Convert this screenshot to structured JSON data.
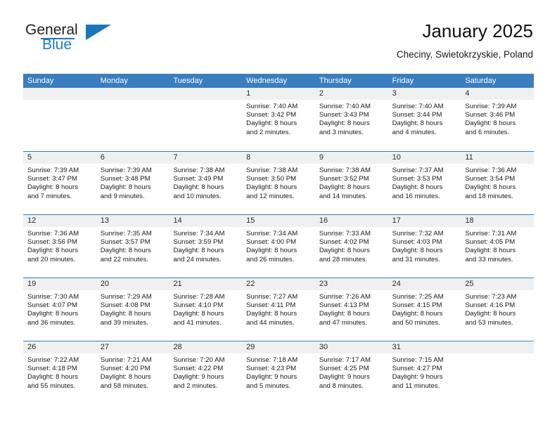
{
  "brand": {
    "name_part1": "General",
    "name_part2": "Blue",
    "accent_color": "#1b75bb"
  },
  "header": {
    "title": "January 2025",
    "location": "Checiny, Swietokrzyskie, Poland"
  },
  "calendar": {
    "header_bg": "#3a7ebf",
    "daynumber_bg": "#f0f0f0",
    "weekdays": [
      "Sunday",
      "Monday",
      "Tuesday",
      "Wednesday",
      "Thursday",
      "Friday",
      "Saturday"
    ],
    "weeks": [
      [
        {
          "day": "",
          "sunrise": "",
          "sunset": "",
          "daylight_line1": "",
          "daylight_line2": ""
        },
        {
          "day": "",
          "sunrise": "",
          "sunset": "",
          "daylight_line1": "",
          "daylight_line2": ""
        },
        {
          "day": "",
          "sunrise": "",
          "sunset": "",
          "daylight_line1": "",
          "daylight_line2": ""
        },
        {
          "day": "1",
          "sunrise": "Sunrise: 7:40 AM",
          "sunset": "Sunset: 3:42 PM",
          "daylight_line1": "Daylight: 8 hours",
          "daylight_line2": "and 2 minutes."
        },
        {
          "day": "2",
          "sunrise": "Sunrise: 7:40 AM",
          "sunset": "Sunset: 3:43 PM",
          "daylight_line1": "Daylight: 8 hours",
          "daylight_line2": "and 3 minutes."
        },
        {
          "day": "3",
          "sunrise": "Sunrise: 7:40 AM",
          "sunset": "Sunset: 3:44 PM",
          "daylight_line1": "Daylight: 8 hours",
          "daylight_line2": "and 4 minutes."
        },
        {
          "day": "4",
          "sunrise": "Sunrise: 7:39 AM",
          "sunset": "Sunset: 3:46 PM",
          "daylight_line1": "Daylight: 8 hours",
          "daylight_line2": "and 6 minutes."
        }
      ],
      [
        {
          "day": "5",
          "sunrise": "Sunrise: 7:39 AM",
          "sunset": "Sunset: 3:47 PM",
          "daylight_line1": "Daylight: 8 hours",
          "daylight_line2": "and 7 minutes."
        },
        {
          "day": "6",
          "sunrise": "Sunrise: 7:39 AM",
          "sunset": "Sunset: 3:48 PM",
          "daylight_line1": "Daylight: 8 hours",
          "daylight_line2": "and 9 minutes."
        },
        {
          "day": "7",
          "sunrise": "Sunrise: 7:38 AM",
          "sunset": "Sunset: 3:49 PM",
          "daylight_line1": "Daylight: 8 hours",
          "daylight_line2": "and 10 minutes."
        },
        {
          "day": "8",
          "sunrise": "Sunrise: 7:38 AM",
          "sunset": "Sunset: 3:50 PM",
          "daylight_line1": "Daylight: 8 hours",
          "daylight_line2": "and 12 minutes."
        },
        {
          "day": "9",
          "sunrise": "Sunrise: 7:38 AM",
          "sunset": "Sunset: 3:52 PM",
          "daylight_line1": "Daylight: 8 hours",
          "daylight_line2": "and 14 minutes."
        },
        {
          "day": "10",
          "sunrise": "Sunrise: 7:37 AM",
          "sunset": "Sunset: 3:53 PM",
          "daylight_line1": "Daylight: 8 hours",
          "daylight_line2": "and 16 minutes."
        },
        {
          "day": "11",
          "sunrise": "Sunrise: 7:36 AM",
          "sunset": "Sunset: 3:54 PM",
          "daylight_line1": "Daylight: 8 hours",
          "daylight_line2": "and 18 minutes."
        }
      ],
      [
        {
          "day": "12",
          "sunrise": "Sunrise: 7:36 AM",
          "sunset": "Sunset: 3:56 PM",
          "daylight_line1": "Daylight: 8 hours",
          "daylight_line2": "and 20 minutes."
        },
        {
          "day": "13",
          "sunrise": "Sunrise: 7:35 AM",
          "sunset": "Sunset: 3:57 PM",
          "daylight_line1": "Daylight: 8 hours",
          "daylight_line2": "and 22 minutes."
        },
        {
          "day": "14",
          "sunrise": "Sunrise: 7:34 AM",
          "sunset": "Sunset: 3:59 PM",
          "daylight_line1": "Daylight: 8 hours",
          "daylight_line2": "and 24 minutes."
        },
        {
          "day": "15",
          "sunrise": "Sunrise: 7:34 AM",
          "sunset": "Sunset: 4:00 PM",
          "daylight_line1": "Daylight: 8 hours",
          "daylight_line2": "and 26 minutes."
        },
        {
          "day": "16",
          "sunrise": "Sunrise: 7:33 AM",
          "sunset": "Sunset: 4:02 PM",
          "daylight_line1": "Daylight: 8 hours",
          "daylight_line2": "and 28 minutes."
        },
        {
          "day": "17",
          "sunrise": "Sunrise: 7:32 AM",
          "sunset": "Sunset: 4:03 PM",
          "daylight_line1": "Daylight: 8 hours",
          "daylight_line2": "and 31 minutes."
        },
        {
          "day": "18",
          "sunrise": "Sunrise: 7:31 AM",
          "sunset": "Sunset: 4:05 PM",
          "daylight_line1": "Daylight: 8 hours",
          "daylight_line2": "and 33 minutes."
        }
      ],
      [
        {
          "day": "19",
          "sunrise": "Sunrise: 7:30 AM",
          "sunset": "Sunset: 4:07 PM",
          "daylight_line1": "Daylight: 8 hours",
          "daylight_line2": "and 36 minutes."
        },
        {
          "day": "20",
          "sunrise": "Sunrise: 7:29 AM",
          "sunset": "Sunset: 4:08 PM",
          "daylight_line1": "Daylight: 8 hours",
          "daylight_line2": "and 39 minutes."
        },
        {
          "day": "21",
          "sunrise": "Sunrise: 7:28 AM",
          "sunset": "Sunset: 4:10 PM",
          "daylight_line1": "Daylight: 8 hours",
          "daylight_line2": "and 41 minutes."
        },
        {
          "day": "22",
          "sunrise": "Sunrise: 7:27 AM",
          "sunset": "Sunset: 4:11 PM",
          "daylight_line1": "Daylight: 8 hours",
          "daylight_line2": "and 44 minutes."
        },
        {
          "day": "23",
          "sunrise": "Sunrise: 7:26 AM",
          "sunset": "Sunset: 4:13 PM",
          "daylight_line1": "Daylight: 8 hours",
          "daylight_line2": "and 47 minutes."
        },
        {
          "day": "24",
          "sunrise": "Sunrise: 7:25 AM",
          "sunset": "Sunset: 4:15 PM",
          "daylight_line1": "Daylight: 8 hours",
          "daylight_line2": "and 50 minutes."
        },
        {
          "day": "25",
          "sunrise": "Sunrise: 7:23 AM",
          "sunset": "Sunset: 4:16 PM",
          "daylight_line1": "Daylight: 8 hours",
          "daylight_line2": "and 53 minutes."
        }
      ],
      [
        {
          "day": "26",
          "sunrise": "Sunrise: 7:22 AM",
          "sunset": "Sunset: 4:18 PM",
          "daylight_line1": "Daylight: 8 hours",
          "daylight_line2": "and 55 minutes."
        },
        {
          "day": "27",
          "sunrise": "Sunrise: 7:21 AM",
          "sunset": "Sunset: 4:20 PM",
          "daylight_line1": "Daylight: 8 hours",
          "daylight_line2": "and 58 minutes."
        },
        {
          "day": "28",
          "sunrise": "Sunrise: 7:20 AM",
          "sunset": "Sunset: 4:22 PM",
          "daylight_line1": "Daylight: 9 hours",
          "daylight_line2": "and 2 minutes."
        },
        {
          "day": "29",
          "sunrise": "Sunrise: 7:18 AM",
          "sunset": "Sunset: 4:23 PM",
          "daylight_line1": "Daylight: 9 hours",
          "daylight_line2": "and 5 minutes."
        },
        {
          "day": "30",
          "sunrise": "Sunrise: 7:17 AM",
          "sunset": "Sunset: 4:25 PM",
          "daylight_line1": "Daylight: 9 hours",
          "daylight_line2": "and 8 minutes."
        },
        {
          "day": "31",
          "sunrise": "Sunrise: 7:15 AM",
          "sunset": "Sunset: 4:27 PM",
          "daylight_line1": "Daylight: 9 hours",
          "daylight_line2": "and 11 minutes."
        },
        {
          "day": "",
          "sunrise": "",
          "sunset": "",
          "daylight_line1": "",
          "daylight_line2": ""
        }
      ]
    ]
  }
}
